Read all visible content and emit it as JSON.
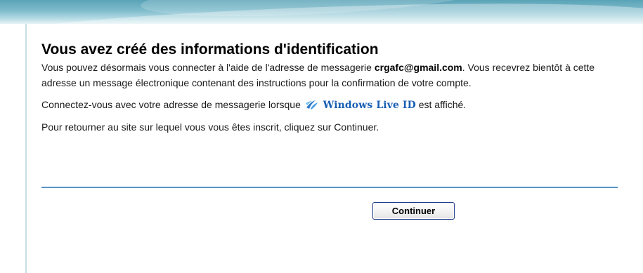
{
  "page": {
    "title": "Vous avez créé des informations d'identification",
    "paragraph1_before": "Vous pouvez désormais vous connecter à l'aide de l'adresse de messagerie ",
    "email": "crgafc@gmail.com",
    "paragraph1_after": ". Vous recevrez bientôt à cette adresse un message électronique contenant des instructions pour la confirmation de votre compte.",
    "paragraph2_before": "Connectez-vous avec votre adresse de messagerie lorsque ",
    "windows_live_id": "Windows Live ID",
    "paragraph2_after": " est affiché.",
    "paragraph3": "Pour retourner au site sur lequel vous vous êtes inscrit, cliquez sur Continuer."
  },
  "actions": {
    "continue_label": "Continuer"
  },
  "icons": {
    "windows_live_logo": "windows-live-icon"
  },
  "colors": {
    "divider": "#5b95c8",
    "link_blue": "#1a5fb4",
    "banner": "#5aa3b7"
  }
}
